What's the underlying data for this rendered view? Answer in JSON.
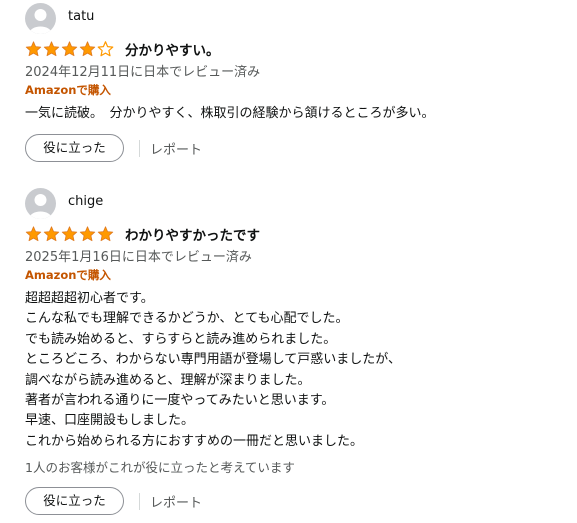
{
  "colors": {
    "star": "#ff9900",
    "verified": "#c45500",
    "muted": "#565959"
  },
  "reviews": [
    {
      "username": "tatu",
      "rating": 4,
      "rating_max": 5,
      "title": "分かりやすい。",
      "date": "2024年12月11日に日本でレビュー済み",
      "verified": "Amazonで購入",
      "body": [
        "一気に読破。　分かりやすく、株取引の経験から頷けるところが多い。"
      ],
      "helpful_button": "役に立った",
      "report": "レポート"
    },
    {
      "username": "chige",
      "rating": 5,
      "rating_max": 5,
      "title": "わかりやすかったです",
      "date": "2025年1月16日に日本でレビュー済み",
      "verified": "Amazonで購入",
      "body": [
        "超超超超初心者です。",
        "こんな私でも理解できるかどうか、とても心配でした。",
        "でも読み始めると、すらすらと読み進められました。",
        "ところどころ、わからない専門用語が登場して戸惑いましたが、",
        "調べながら読み進めると、理解が深まりました。",
        "著者が言われる通りに一度やってみたいと思います。",
        "早速、口座開設もしました。",
        "これから始められる方におすすめの一冊だと思いました。"
      ],
      "helpful_count": "1人のお客様がこれが役に立ったと考えています",
      "helpful_button": "役に立った",
      "report": "レポート"
    }
  ]
}
